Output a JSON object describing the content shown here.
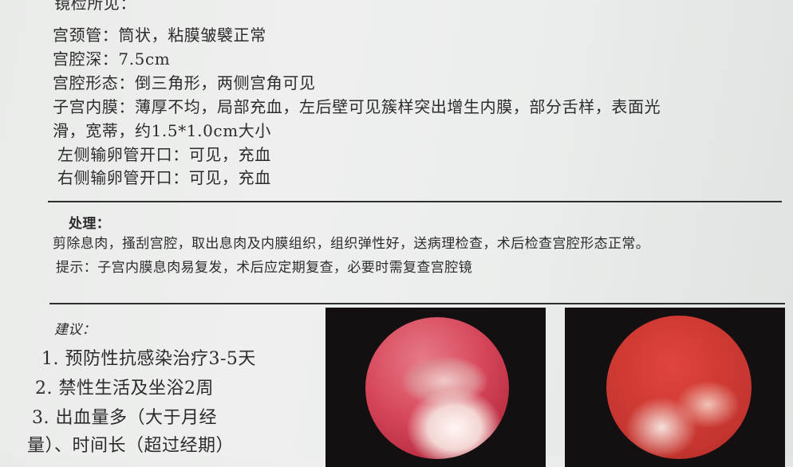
{
  "findings": {
    "heading": "镜检所见：",
    "lines": [
      "宫颈管：筒状，粘膜皱襞正常",
      "宫腔深：7.5cm",
      "宫腔形态：倒三角形，两侧宫角可见",
      "子宫内膜：薄厚不均，局部充血，左后壁可见簇样突出增生内膜，部分舌样，表面光",
      "滑，宽蒂，约1.5*1.0cm大小",
      "左侧输卵管开口：可见，充血",
      "右侧输卵管开口：可见，充血"
    ]
  },
  "treatment": {
    "heading": "处理：",
    "procedure": "剪除息肉，搔刮宫腔，取出息肉及内膜组织，组织弹性好，送病理检查，术后检查宫腔形态正常。",
    "note": "提示：子宫内膜息肉易复发，术后应定期复查，必要时需复查宫腔镜"
  },
  "advice": {
    "heading": "建议：",
    "items": [
      "1. 预防性抗感染治疗3-5天",
      "2. 禁性生活及坐浴2周",
      "3. 出血量多（大于月经",
      "量）、时间长（超过经期）"
    ]
  }
}
